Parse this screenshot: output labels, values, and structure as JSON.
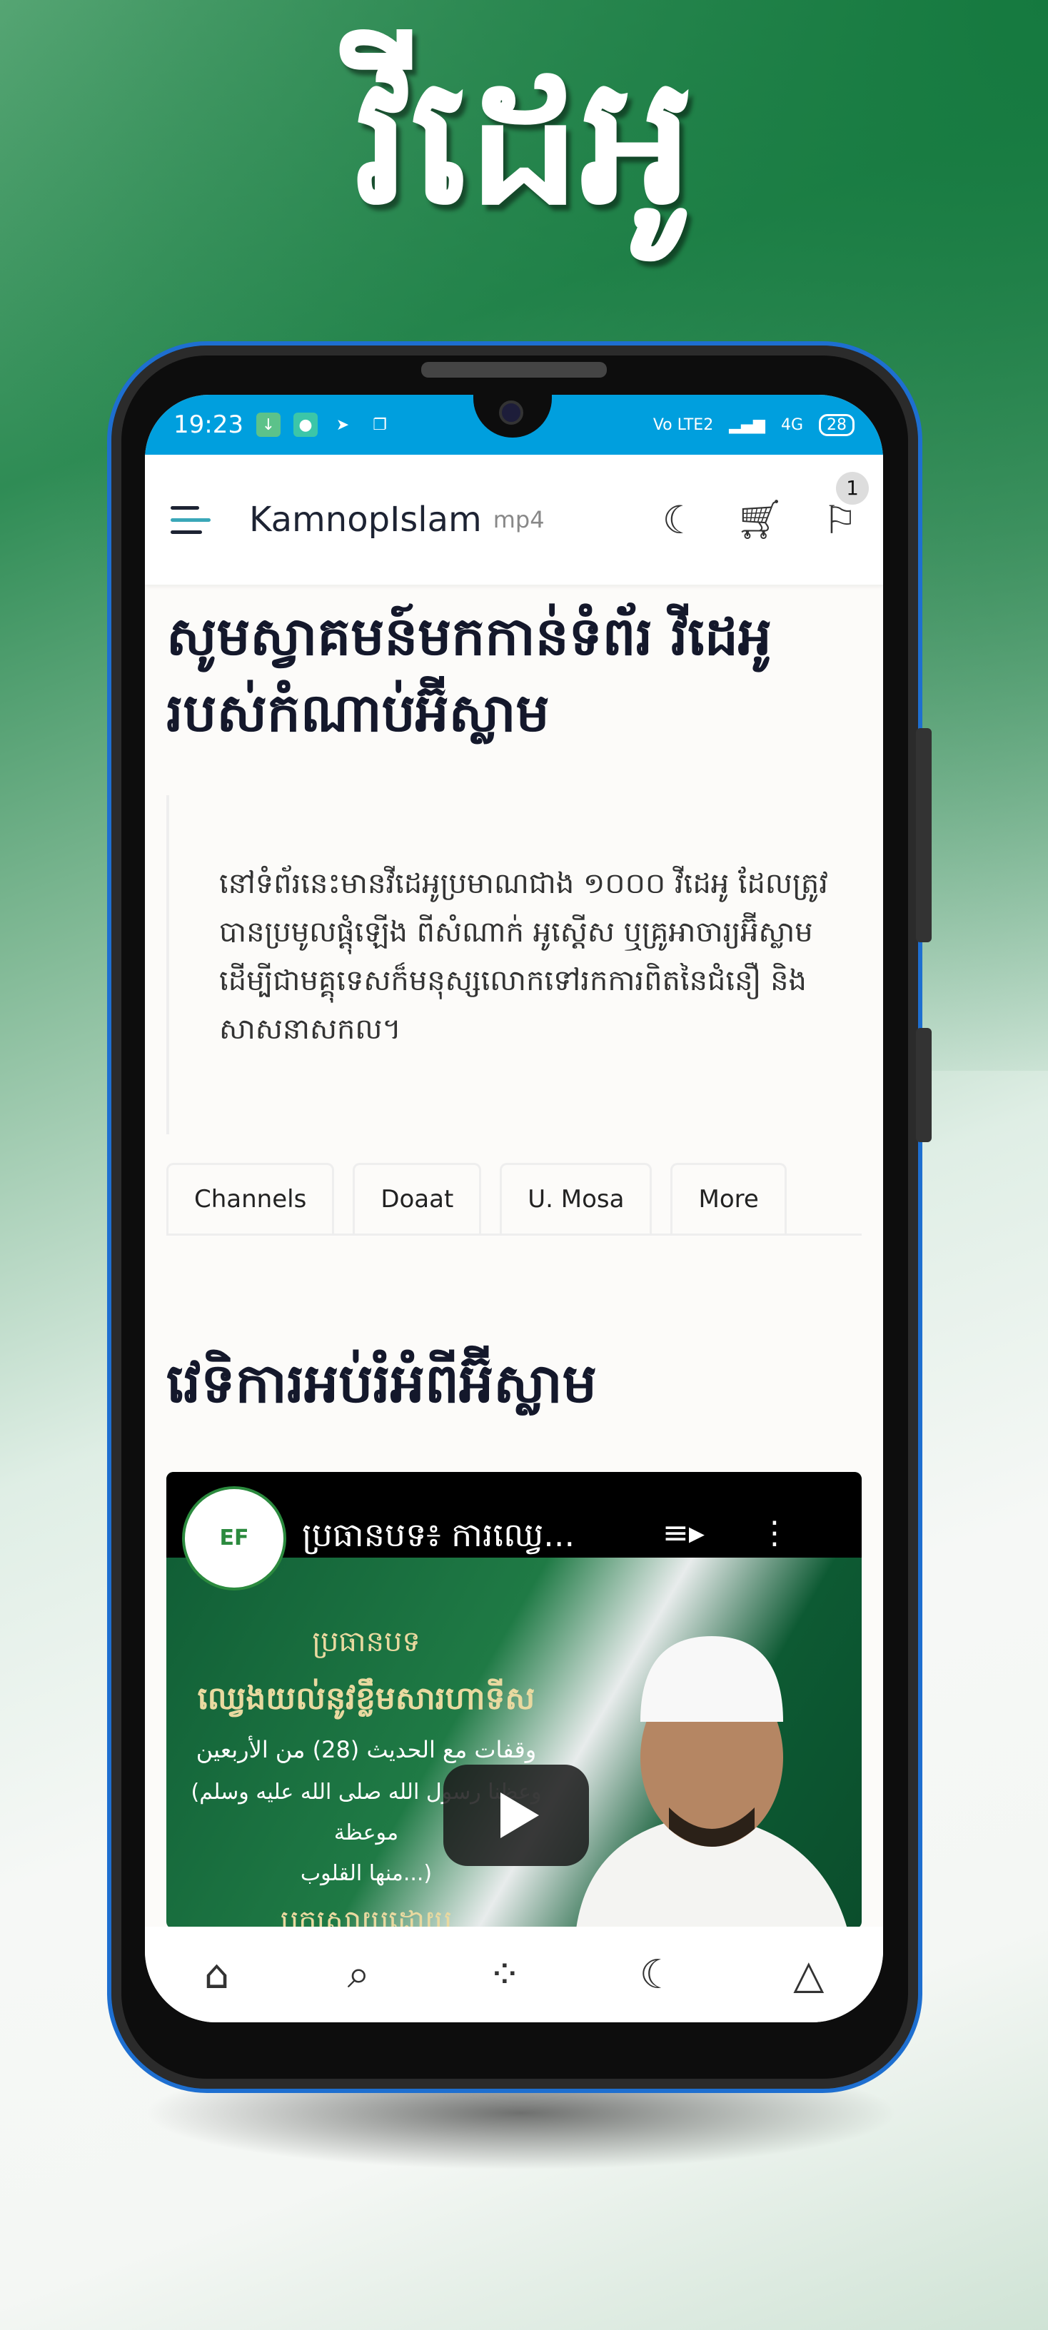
{
  "hero_title": "វីដេអូ",
  "status": {
    "time": "19:23",
    "network": "4G",
    "volte": "Vo LTE2",
    "battery": "28"
  },
  "appbar": {
    "title": "KamnopIslam",
    "subtitle": "mp4",
    "badge_count": "1"
  },
  "welcome": "សូមស្វាគមន៍មកកាន់ទំព័រ វីដេអូ របស់កំណាប់អ៊ីស្លាម",
  "intro": "នៅទំព័រនេះមានវីដេអូប្រមាណជាង ១០០០ វីដេអូ ដែលត្រូវបានប្រមូលផ្តុំឡើង ពីសំណាក់ អូស្តើស ឬគ្រូអាចារ្យអ៊ីស្លាម ដើម្បីជាមគ្គុទេសក៏មនុស្សលោកទៅរកការពិតនៃជំនឿ និងសាសនាសកល។",
  "tabs": [
    {
      "label": "Channels"
    },
    {
      "label": "Doaat"
    },
    {
      "label": "U. Mosa"
    },
    {
      "label": "More"
    }
  ],
  "section_title": "វេទិការអប់រំអំពីអ៊ីស្លាម",
  "video": {
    "title": "ប្រធានបទ៖ ការឈ្វេ...",
    "thumb_lines": [
      "ប្រធានបទ",
      "ឈ្វេងយល់នូវខ្លឹមសារហាទីស",
      "وقفات مع الحديث (28) من الأربعين",
      "(وعظنا رسول الله صلى الله عليه وسلم موعظة",
      "منها القلوب...)",
      "បកស្រាយដោយ"
    ],
    "logo_text": "EF"
  },
  "colors": {
    "status_bar": "#009fde",
    "phone_border": "#1e6fd0",
    "brand_green": "#15793f"
  },
  "bottom_nav": [
    {
      "icon": "home-icon"
    },
    {
      "icon": "search-icon"
    },
    {
      "icon": "grid-icon"
    },
    {
      "icon": "moon-icon"
    },
    {
      "icon": "bell-icon"
    }
  ]
}
